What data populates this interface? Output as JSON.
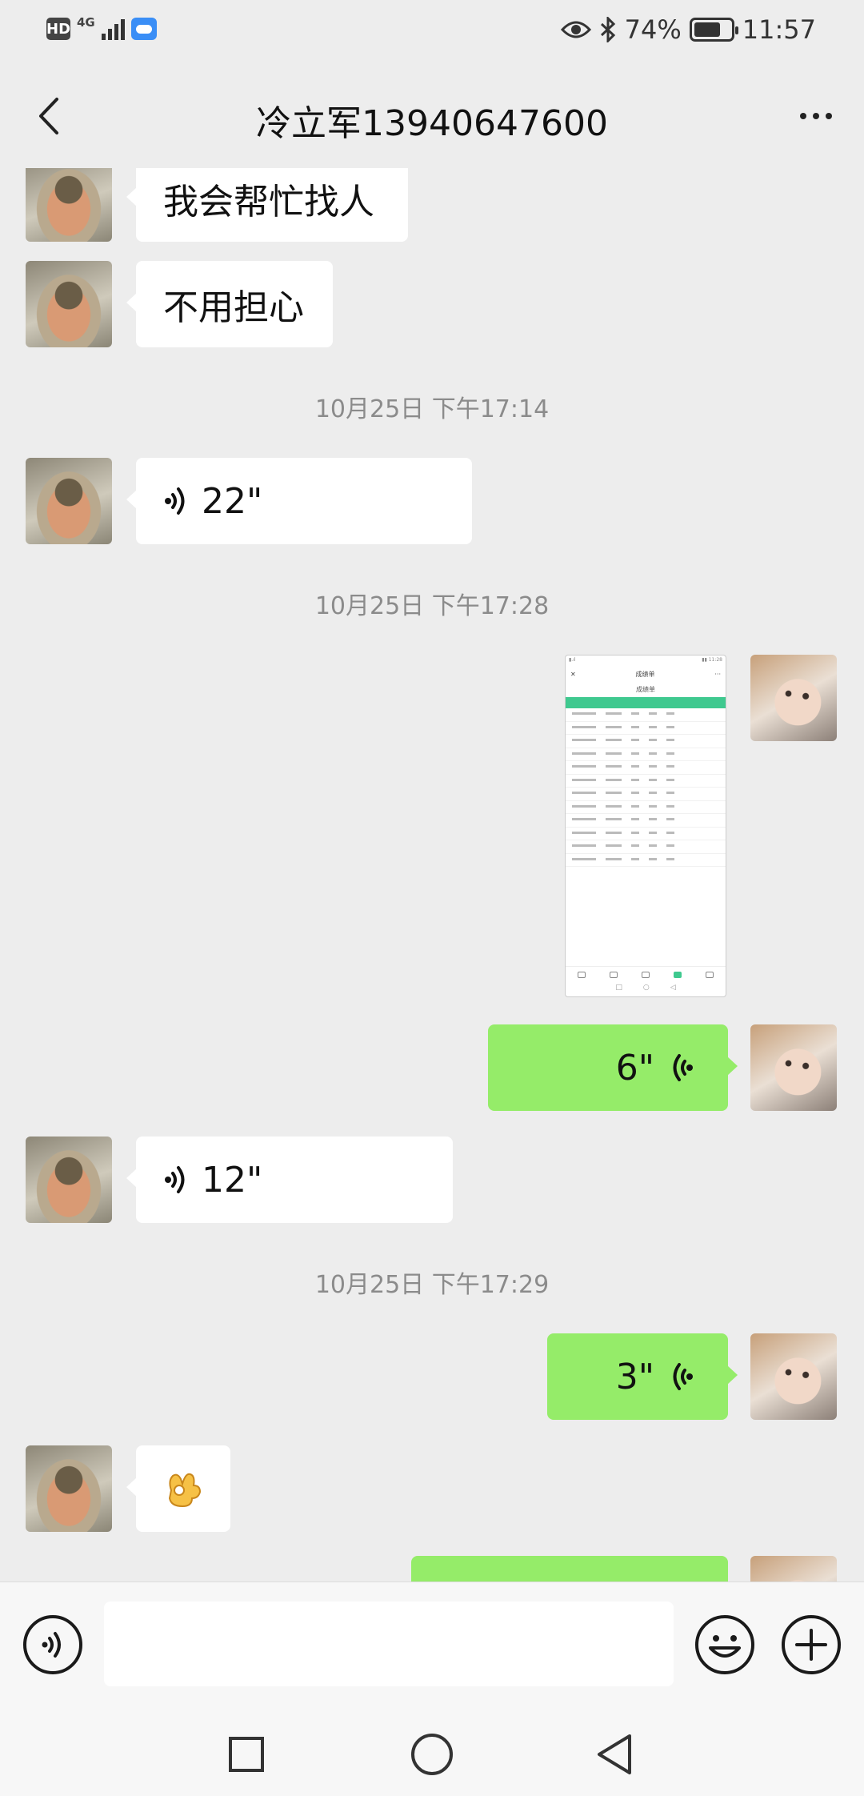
{
  "status_bar": {
    "hd": "HD",
    "network": "4G",
    "battery_percent": "74%",
    "battery_level": 0.74,
    "time": "11:57"
  },
  "header": {
    "title": "冷立军13940647600",
    "back_icon": "chevron-left-icon",
    "more_icon": "more-dots-icon"
  },
  "messages": [
    {
      "type": "text",
      "side": "in",
      "text": "我会帮忙找人"
    },
    {
      "type": "text",
      "side": "in",
      "text": "不用担心"
    },
    {
      "type": "timestamp",
      "text": "10月25日 下午17:14"
    },
    {
      "type": "voice",
      "side": "in",
      "duration": "22\""
    },
    {
      "type": "timestamp",
      "text": "10月25日 下午17:28"
    },
    {
      "type": "image",
      "side": "out",
      "thumbnail": {
        "title": "成绩单",
        "subtitle": "成绩单"
      }
    },
    {
      "type": "voice",
      "side": "out",
      "duration": "6\""
    },
    {
      "type": "voice",
      "side": "in",
      "duration": "12\""
    },
    {
      "type": "timestamp",
      "text": "10月25日 下午17:29"
    },
    {
      "type": "voice",
      "side": "out",
      "duration": "3\""
    },
    {
      "type": "emoji",
      "side": "in",
      "emoji": "ok-hand-emoji"
    },
    {
      "type": "partial",
      "side": "out"
    }
  ],
  "input_bar": {
    "voice_toggle_icon": "voice-mode-icon",
    "text_value": "",
    "emoji_icon": "emoji-smile-icon",
    "plus_icon": "plus-circle-icon"
  },
  "nav_bar": {
    "recent_icon": "square-recent-icon",
    "home_icon": "circle-home-icon",
    "back_icon": "triangle-back-icon"
  },
  "colors": {
    "background": "#ededed",
    "incoming_bubble": "#ffffff",
    "outgoing_bubble": "#95ec69",
    "timestamp_text": "#8b8b8b",
    "thumbnail_accent": "#3fc98f"
  }
}
